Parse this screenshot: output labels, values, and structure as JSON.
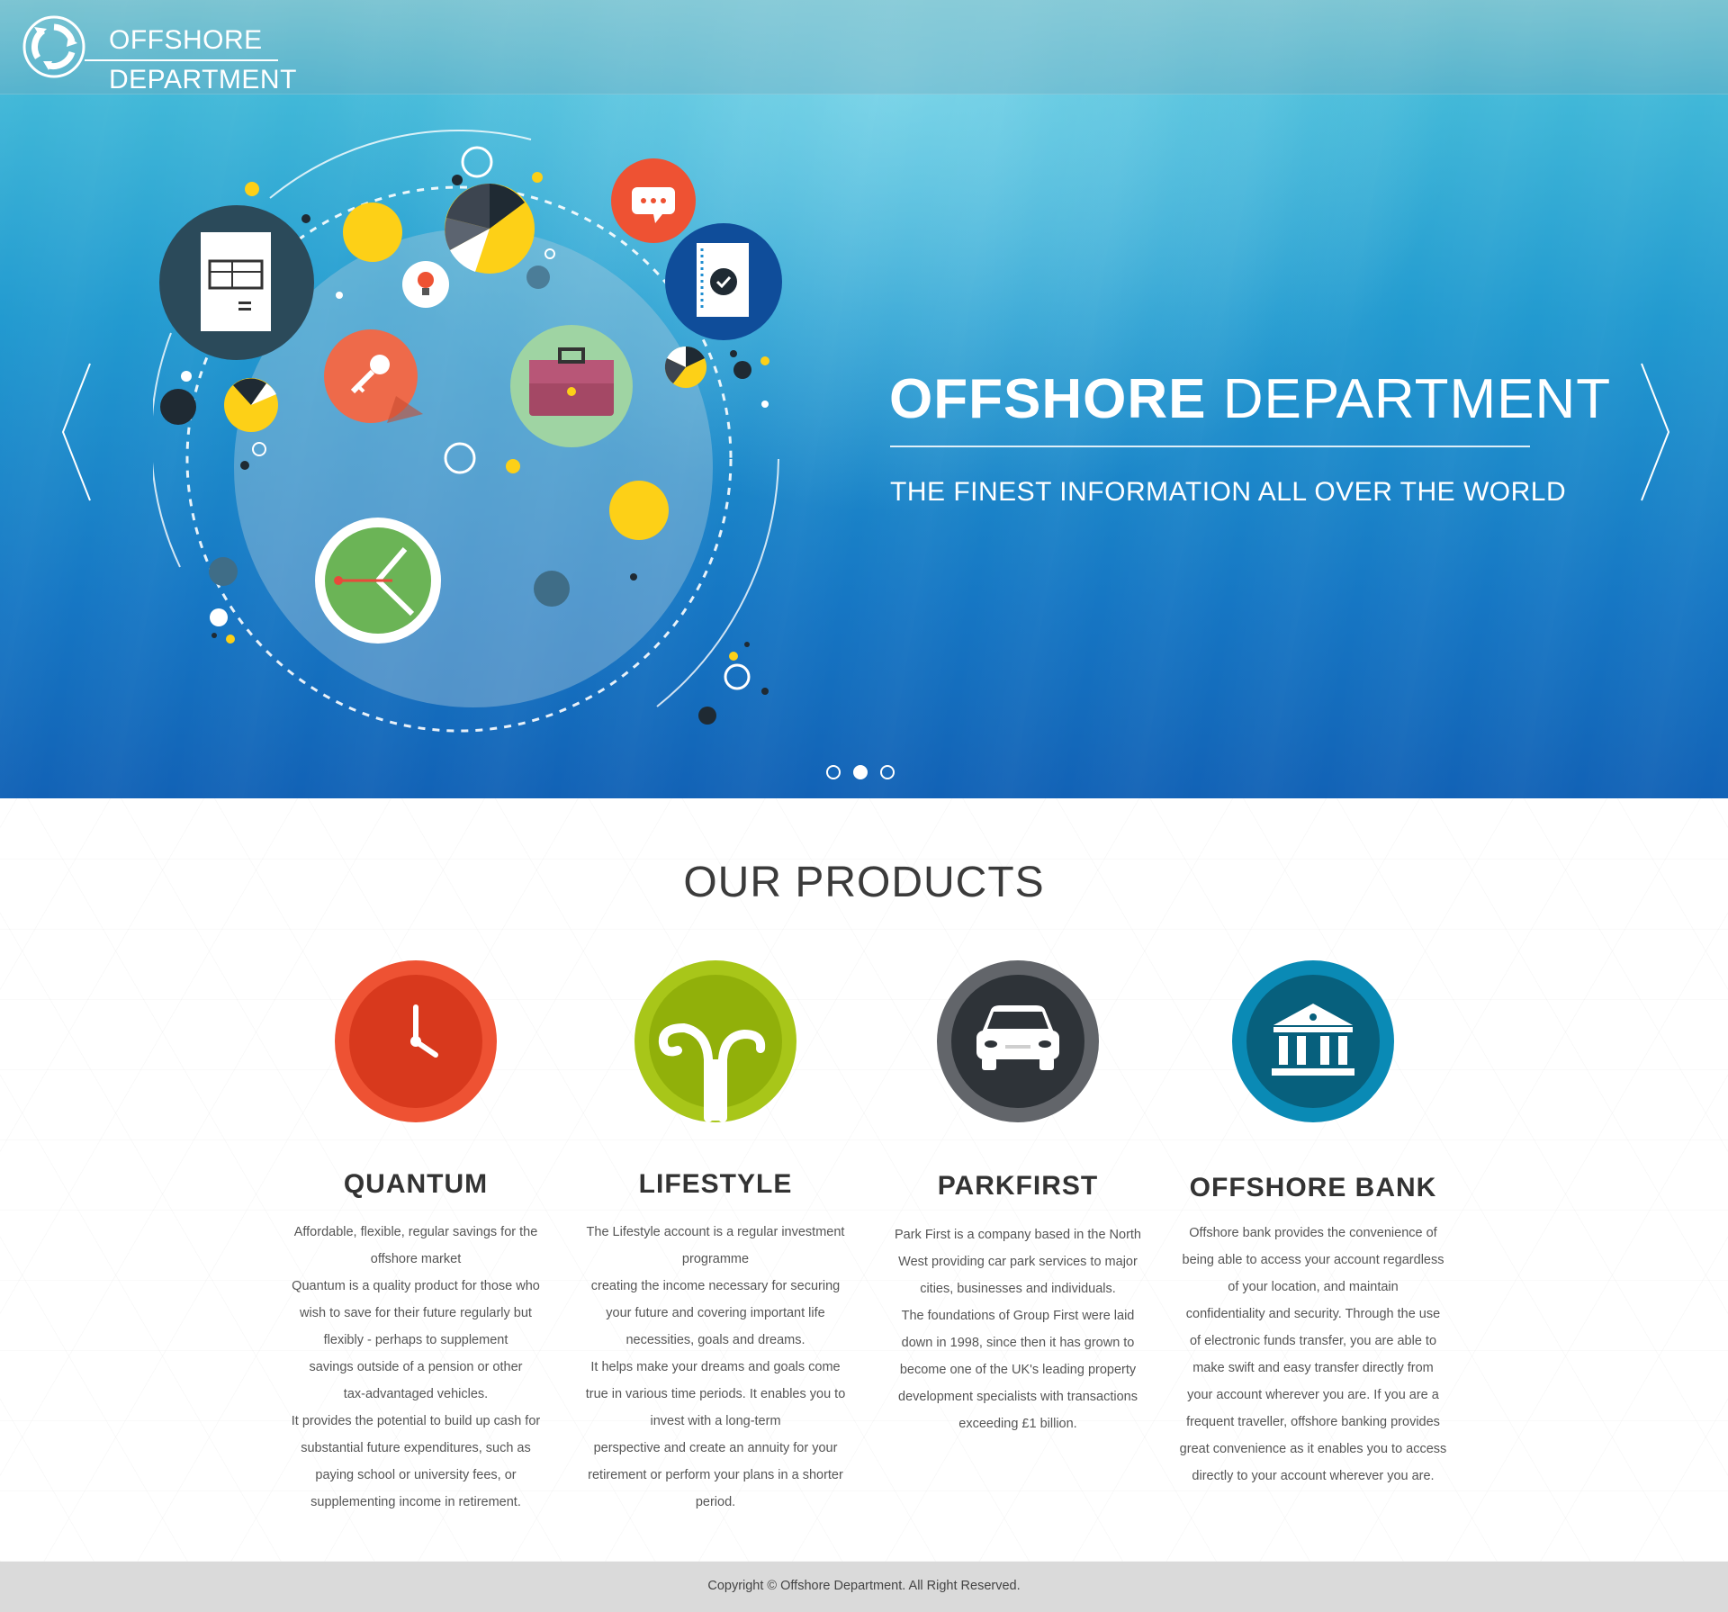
{
  "brand": {
    "line1": "OFFSHORE",
    "line2": "DEPARTMENT"
  },
  "hero": {
    "title_bold": "OFFSHORE",
    "title_light": "DEPARTMENT",
    "subtitle": "THE FINEST INFORMATION ALL OVER THE WORLD",
    "slides_total": 3,
    "active_slide": 2
  },
  "products": {
    "heading": "OUR PRODUCTS",
    "items": [
      {
        "title": "QUANTUM",
        "icon": "clock-icon",
        "lines": [
          "Affordable, flexible, regular savings for the",
          "offshore market",
          "Quantum is a quality product for those who",
          "wish to save for their future regularly but",
          "flexibly - perhaps to supplement",
          "savings outside of a pension or other",
          "tax-advantaged vehicles.",
          "It provides the potential to build up cash for",
          "substantial future expenditures, such as",
          "paying school or university fees, or",
          "supplementing income in retirement."
        ]
      },
      {
        "title": "LIFESTYLE",
        "icon": "sprout-icon",
        "lines": [
          "The Lifestyle account is a regular investment",
          "programme",
          "creating the income necessary for securing",
          "your future and covering important life",
          "necessities, goals and dreams.",
          "It helps make your dreams and goals come",
          "true in various time periods. It enables you to",
          "invest with a long-term",
          "perspective and create an annuity for your",
          "retirement or perform your plans in a shorter",
          "period."
        ]
      },
      {
        "title": "PARKFIRST",
        "icon": "car-icon",
        "lines": [
          "Park First is a company based in the North",
          "West providing car park services to major",
          "cities, businesses and individuals.",
          "The foundations of Group First were laid",
          "down in 1998, since then it has grown to",
          "become one of the UK's leading property",
          "development specialists with transactions",
          "exceeding £1 billion."
        ]
      },
      {
        "title": "OFFSHORE BANK",
        "icon": "bank-icon",
        "lines": [
          "Offshore bank provides the convenience of",
          "being able to access your account regardless",
          "of your location, and maintain",
          "confidentiality and security. Through the use",
          "of electronic funds transfer, you are able to",
          "make swift and easy transfer directly from",
          "your account wherever you are. If you are a",
          "frequent traveller, offshore banking provides",
          "great convenience as it enables you to access",
          "directly to your account wherever you are."
        ]
      }
    ]
  },
  "footer": {
    "copyright": "Copyright © Offshore Department. All Right Reserved."
  },
  "colors": {
    "quantum_outer": "#ee5233",
    "quantum_inner": "#d8391d",
    "lifestyle_outer": "#a8c619",
    "lifestyle_inner": "#91b00a",
    "parkfirst_outer": "#62656a",
    "parkfirst_inner": "#2e3338",
    "bank_outer": "#0a8ab5",
    "bank_inner": "#07607d"
  }
}
